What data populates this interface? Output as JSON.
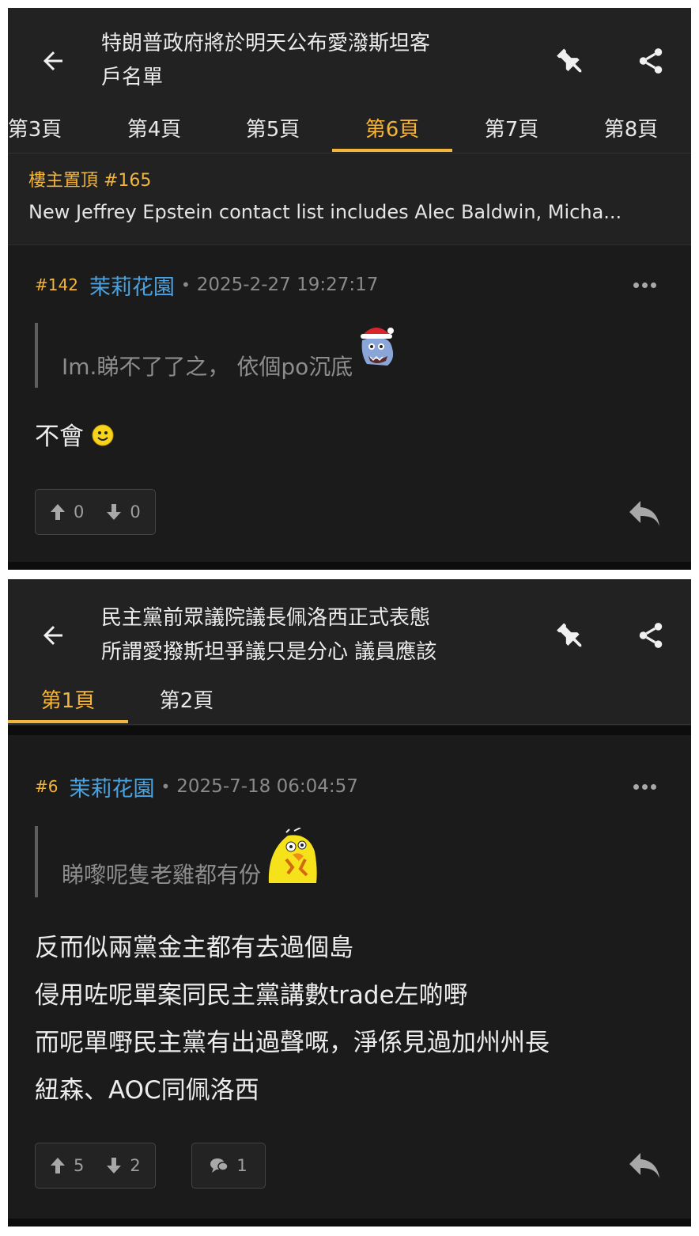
{
  "screen1": {
    "title": "特朗普政府將於明天公布愛潑斯坦客戶名單",
    "title_line1": "特朗普政府將於明天公布愛潑斯坦客",
    "title_line2": "戶名單",
    "tabs": [
      {
        "label": "第3頁",
        "active": false
      },
      {
        "label": "第4頁",
        "active": false
      },
      {
        "label": "第5頁",
        "active": false
      },
      {
        "label": "第6頁",
        "active": true
      },
      {
        "label": "第7頁",
        "active": false
      },
      {
        "label": "第8頁",
        "active": false
      }
    ],
    "pinned": {
      "label": "樓主置頂 #165",
      "text": "New Jeffrey Epstein contact list includes Alec Baldwin, Micha..."
    },
    "post": {
      "floor": "#142",
      "author": "茉莉花園",
      "separator": "•",
      "time": "2025-2-27 19:27:17",
      "quote": "Im.睇不了了之， 依個po沉底",
      "quote_emoji": "dragon-santa-emoji",
      "body": "不會",
      "body_emoji": "smiley-emoji",
      "upvotes": "0",
      "downvotes": "0"
    }
  },
  "screen2": {
    "title_line1": "民主黨前眾議院議長佩洛西正式表態",
    "title_line2": "所謂愛撥斯坦爭議只是分心 議員應該",
    "tabs": [
      {
        "label": "第1頁",
        "active": true
      },
      {
        "label": "第2頁",
        "active": false
      }
    ],
    "post": {
      "floor": "#6",
      "author": "茉莉花園",
      "separator": "•",
      "time": "2025-7-18 06:04:57",
      "quote": "睇嚟呢隻老雞都有份",
      "quote_emoji": "yellow-chick-emoji",
      "body_lines": [
        "反而似兩黨金主都有去過個島",
        "侵用咗呢單案同民主黨講數trade左啲嘢",
        "而呢單嘢民主黨有出過聲嘅，淨係見過加州州長",
        "紐森、AOC同佩洛西"
      ],
      "upvotes": "5",
      "downvotes": "2",
      "comments": "1"
    }
  },
  "colors": {
    "accent": "#f3b53c",
    "author": "#4aa3e0",
    "background": "#1b1b1b",
    "header": "#222222"
  }
}
